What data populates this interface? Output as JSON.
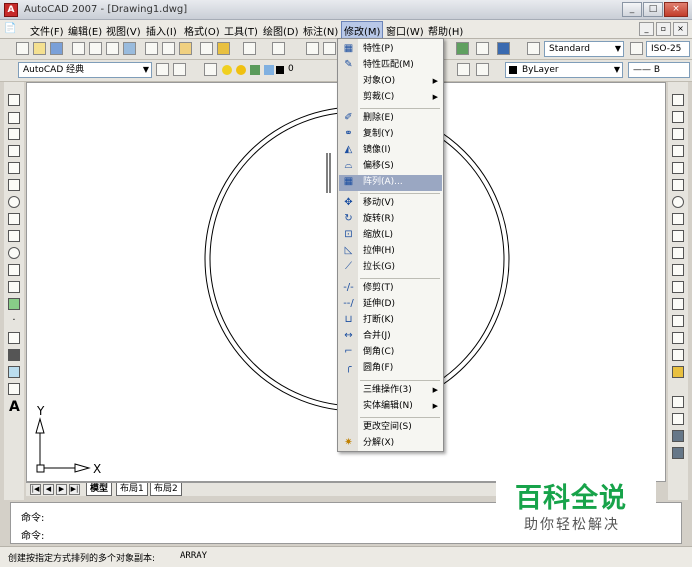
{
  "window": {
    "title": "AutoCAD 2007 - [Drawing1.dwg]",
    "app_icon": "autocad-app-icon",
    "minimize_glyph": "_",
    "maximize_glyph": "□",
    "close_glyph": "×",
    "doc_minimize_glyph": "_",
    "doc_restore_glyph": "▫",
    "doc_close_glyph": "×"
  },
  "menubar": {
    "file_label": "文件(F)",
    "edit_label": "编辑(E)",
    "view_label": "视图(V)",
    "insert_label": "插入(I)",
    "format_label": "格式(O)",
    "tools_label": "工具(T)",
    "draw_label": "绘图(D)",
    "dimension_label": "标注(N)",
    "modify_label": "修改(M)",
    "window_label": "窗口(W)",
    "help_label": "帮助(H)"
  },
  "toolbar1": {
    "text_style": "Standard",
    "dim_style": "ISO-25"
  },
  "toolbar2": {
    "workspace": "AutoCAD 经典",
    "layer_value": "0",
    "color_value": "ByLayer",
    "linetype_value": "—— B"
  },
  "ucs": {
    "y_label": "Y",
    "x_label": "X"
  },
  "layout_tabs": {
    "model_label": "模型",
    "layout1_label": "布局1",
    "layout2_label": "布局2"
  },
  "command": {
    "line1": "命令:",
    "line2": "命令:"
  },
  "status": {
    "text": "创建按指定方式排列的多个对象副本:",
    "command_name": "ARRAY"
  },
  "dropdown": {
    "items": [
      {
        "label": "特性(P)",
        "icon": "properties-icon"
      },
      {
        "label": "特性匹配(M)",
        "icon": "match-properties-icon"
      },
      {
        "label": "对象(O)",
        "icon": "",
        "submenu": true
      },
      {
        "label": "剪裁(C)",
        "icon": "",
        "submenu": true
      },
      {
        "label": "删除(E)",
        "icon": "erase-icon"
      },
      {
        "label": "复制(Y)",
        "icon": "copy-icon"
      },
      {
        "label": "镜像(I)",
        "icon": "mirror-icon"
      },
      {
        "label": "偏移(S)",
        "icon": "offset-icon"
      },
      {
        "label": "阵列(A)...",
        "icon": "array-icon",
        "highlighted": true
      },
      {
        "label": "移动(V)",
        "icon": "move-icon"
      },
      {
        "label": "旋转(R)",
        "icon": "rotate-icon"
      },
      {
        "label": "缩放(L)",
        "icon": "scale-icon"
      },
      {
        "label": "拉伸(H)",
        "icon": "stretch-icon"
      },
      {
        "label": "拉长(G)",
        "icon": "lengthen-icon"
      },
      {
        "label": "修剪(T)",
        "icon": "trim-icon"
      },
      {
        "label": "延伸(D)",
        "icon": "extend-icon"
      },
      {
        "label": "打断(K)",
        "icon": "break-icon"
      },
      {
        "label": "合并(J)",
        "icon": "join-icon"
      },
      {
        "label": "倒角(C)",
        "icon": "chamfer-icon"
      },
      {
        "label": "圆角(F)",
        "icon": "fillet-icon"
      },
      {
        "label": "三维操作(3)",
        "icon": "",
        "submenu": true
      },
      {
        "label": "实体编辑(N)",
        "icon": "",
        "submenu": true
      },
      {
        "label": "更改空间(S)",
        "icon": ""
      },
      {
        "label": "分解(X)",
        "icon": "explode-icon"
      }
    ],
    "submenu_glyph": "▶"
  },
  "watermark": {
    "title": "百科全说",
    "subtitle": "助你轻松解决"
  },
  "colors": {
    "menu_highlight": "#9aa7c2",
    "arrow_red": "#e02020",
    "watermark_green": "#17a34a"
  }
}
